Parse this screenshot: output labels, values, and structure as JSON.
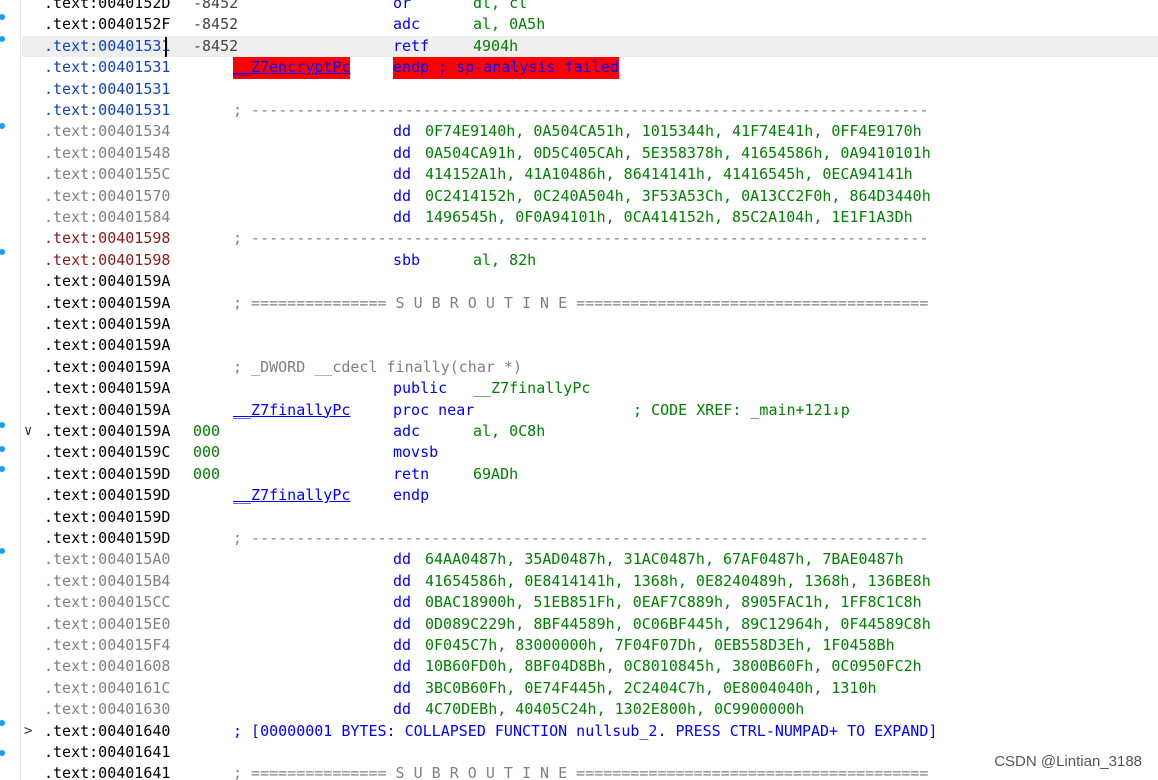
{
  "listing": {
    "rows": [
      {
        "addr": ".text:0040152D",
        "addr_style": "normal",
        "sp": "-8452",
        "mnem": "or",
        "operand": "dl, cl"
      },
      {
        "addr": ".text:0040152F",
        "addr_style": "normal",
        "sp": "-8452",
        "mnem": "adc",
        "operand": "al, 0A5h"
      },
      {
        "addr": ".text:00401531",
        "addr_style": "blue",
        "sp": "-8452",
        "mnem": "retf",
        "operand": "4904h",
        "current": true
      },
      {
        "addr": ".text:00401531",
        "addr_style": "blue",
        "label": "__Z7encryptPc",
        "label_style": "error",
        "endp": "endp ; sp-analysis failed"
      },
      {
        "addr": ".text:00401531",
        "addr_style": "blue"
      },
      {
        "addr": ".text:00401531",
        "addr_style": "blue",
        "separator": "; ---------------------------------------------------------------------------"
      },
      {
        "addr": ".text:00401534",
        "addr_style": "dim",
        "dd": "0F74E9140h, 0A504CA51h, 1015344h, 41F74E41h, 0FF4E9170h"
      },
      {
        "addr": ".text:00401548",
        "addr_style": "dim",
        "dd": "0A504CA91h, 0D5C405CAh, 5E358378h, 41654586h, 0A9410101h"
      },
      {
        "addr": ".text:0040155C",
        "addr_style": "dim",
        "dd": "414152A1h, 41A10486h, 86414141h, 41416545h, 0ECA94141h"
      },
      {
        "addr": ".text:00401570",
        "addr_style": "dim",
        "dd": "0C2414152h, 0C240A504h, 3F53A53Ch, 0A13CC2F0h, 864D3440h"
      },
      {
        "addr": ".text:00401584",
        "addr_style": "dim",
        "dd": "1496545h, 0F0A94101h, 0CA414152h, 85C2A104h, 1E1F1A3Dh"
      },
      {
        "addr": ".text:00401598",
        "addr_style": "red",
        "separator": "; ---------------------------------------------------------------------------"
      },
      {
        "addr": ".text:00401598",
        "addr_style": "red",
        "mnem": "sbb",
        "operand": "al, 82h"
      },
      {
        "addr": ".text:0040159A",
        "addr_style": "normal"
      },
      {
        "addr": ".text:0040159A",
        "addr_style": "normal",
        "separator": "; =============== S U B R O U T I N E ======================================="
      },
      {
        "addr": ".text:0040159A",
        "addr_style": "normal"
      },
      {
        "addr": ".text:0040159A",
        "addr_style": "normal"
      },
      {
        "addr": ".text:0040159A",
        "addr_style": "normal",
        "comment": "; _DWORD __cdecl finally(char *)"
      },
      {
        "addr": ".text:0040159A",
        "addr_style": "normal",
        "mnem": "public",
        "operand": "__Z7finallyPc"
      },
      {
        "addr": ".text:0040159A",
        "addr_style": "normal",
        "label": "__Z7finallyPc",
        "mnem": "proc near",
        "xref": "; CODE XREF: _main+121↓p"
      },
      {
        "addr": ".text:0040159A",
        "addr_style": "normal",
        "sp": "000",
        "mnem": "adc",
        "operand": "al, 0C8h",
        "chevron": "∨"
      },
      {
        "addr": ".text:0040159C",
        "addr_style": "normal",
        "sp": "000",
        "mnem": "movsb"
      },
      {
        "addr": ".text:0040159D",
        "addr_style": "normal",
        "sp": "000",
        "mnem": "retn",
        "operand": "69ADh"
      },
      {
        "addr": ".text:0040159D",
        "addr_style": "normal",
        "label": "__Z7finallyPc",
        "mnem": "endp"
      },
      {
        "addr": ".text:0040159D",
        "addr_style": "normal"
      },
      {
        "addr": ".text:0040159D",
        "addr_style": "normal",
        "separator": "; ---------------------------------------------------------------------------"
      },
      {
        "addr": ".text:004015A0",
        "addr_style": "dim",
        "dd": "64AA0487h, 35AD0487h, 31AC0487h, 67AF0487h, 7BAE0487h"
      },
      {
        "addr": ".text:004015B4",
        "addr_style": "dim",
        "dd": "41654586h, 0E8414141h, 1368h, 0E8240489h, 1368h, 136BE8h"
      },
      {
        "addr": ".text:004015CC",
        "addr_style": "dim",
        "dd": "0BAC18900h, 51EB851Fh, 0EAF7C889h, 8905FAC1h, 1FF8C1C8h"
      },
      {
        "addr": ".text:004015E0",
        "addr_style": "dim",
        "dd": "0D089C229h, 8BF44589h, 0C06BF445h, 89C12964h, 0F44589C8h"
      },
      {
        "addr": ".text:004015F4",
        "addr_style": "dim",
        "dd": "0F045C7h, 83000000h, 7F04F07Dh, 0EB558D3Eh, 1F0458Bh"
      },
      {
        "addr": ".text:00401608",
        "addr_style": "dim",
        "dd": "10B60FD0h, 8BF04D8Bh, 0C8010845h, 3800B60Fh, 0C0950FC2h"
      },
      {
        "addr": ".text:0040161C",
        "addr_style": "dim",
        "dd": "3BC0B60Fh, 0E74F445h, 2C2404C7h, 0E8004040h, 1310h"
      },
      {
        "addr": ".text:00401630",
        "addr_style": "dim",
        "dd": "4C70DEBh, 40405C24h, 1302E800h, 0C9900000h"
      },
      {
        "addr": ".text:00401640",
        "addr_style": "normal",
        "collapsed": "; [00000001 BYTES: COLLAPSED FUNCTION nullsub_2. PRESS CTRL-NUMPAD+ TO EXPAND]",
        "chevron": ">"
      },
      {
        "addr": ".text:00401641",
        "addr_style": "normal"
      },
      {
        "addr": ".text:00401641",
        "addr_style": "normal",
        "separator": "; =============== S U B R O U T I N E ======================================="
      }
    ]
  },
  "watermark": "CSDN @Lintian_3188",
  "colors": {
    "error_bg": "#ff0000",
    "keyword_blue": "#0000ff",
    "operand_green": "#008000",
    "comment_gray": "#808080",
    "marker_blue": "#1d9bf0"
  }
}
